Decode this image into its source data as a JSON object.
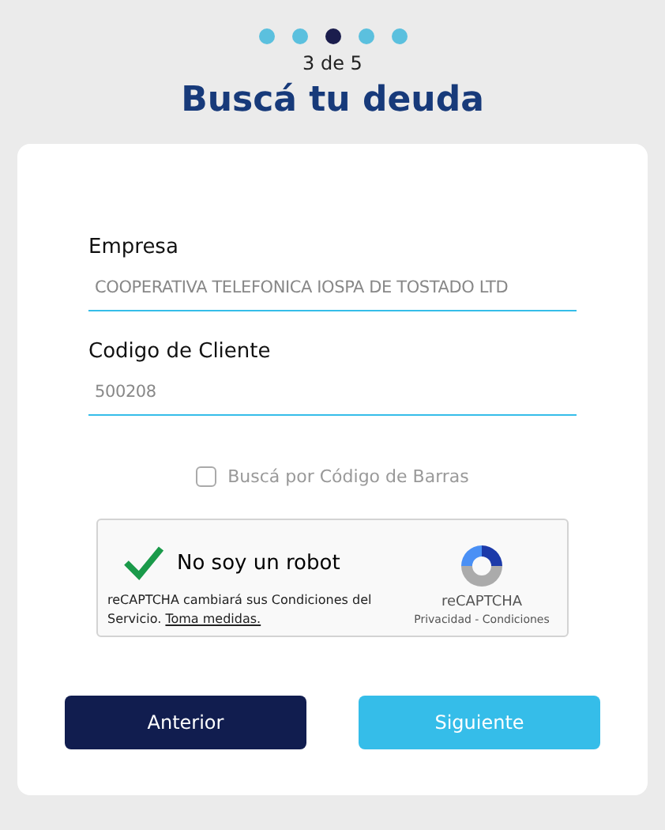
{
  "steps": [
    {
      "selected": false
    },
    {
      "selected": false
    },
    {
      "selected": true
    },
    {
      "selected": false
    },
    {
      "selected": false
    }
  ],
  "step_label": "3 de 5",
  "title": "Buscá tu deuda",
  "fields": [
    {
      "label": "Empresa",
      "value": "COOPERATIVA TELEFONICA IOSPA DE TOSTADO LTD"
    },
    {
      "label": "Codigo de Cliente",
      "value": "500208"
    }
  ],
  "barcode_option": {
    "label": "Buscá por Código de Barras",
    "checked": false
  },
  "captcha": {
    "label": "No soy un robot",
    "checked": true,
    "notice": "reCAPTCHA cambiará sus Condiciones del Servicio.",
    "notice_link": "Toma medidas.",
    "brand": "reCAPTCHA",
    "links": "Privacidad - Condiciones"
  },
  "buttons": [
    {
      "label": "Anterior",
      "kind": "secondary"
    },
    {
      "label": "Siguiente",
      "kind": "primary"
    }
  ]
}
